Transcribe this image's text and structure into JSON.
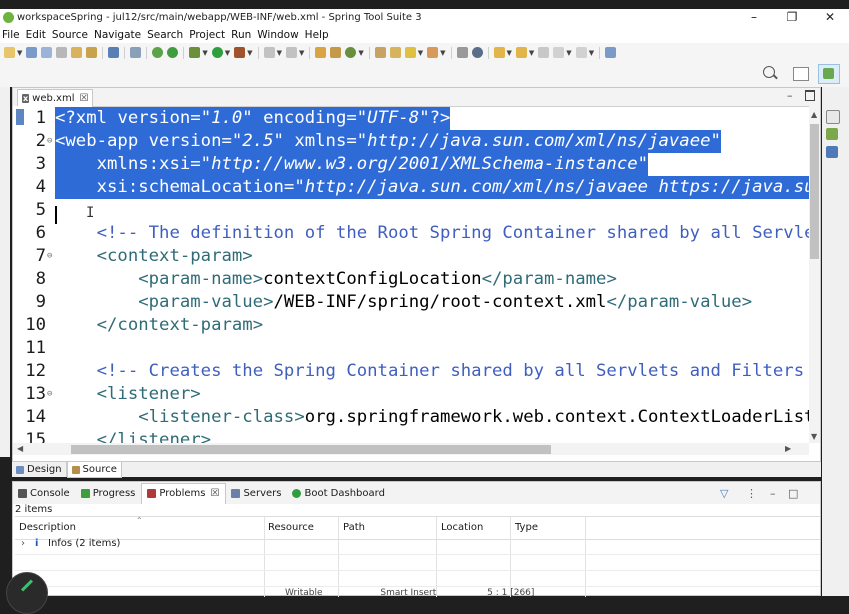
{
  "window": {
    "title": "workspaceSpring - jul12/src/main/webapp/WEB-INF/web.xml - Spring Tool Suite 3",
    "minimize": "–",
    "restore": "❐",
    "close": "✕"
  },
  "menu": [
    "File",
    "Edit",
    "Source",
    "Navigate",
    "Search",
    "Project",
    "Run",
    "Window",
    "Help"
  ],
  "colors": {
    "selection": "#2f6bd7",
    "tag": "#2f6c77",
    "attribute": "#7c1f7c",
    "string": "#2a00ff",
    "comment": "#3f5fbf"
  },
  "editor": {
    "tab": {
      "icon": "x",
      "label": "web.xml",
      "close": "☒"
    },
    "lines": [
      {
        "n": "1",
        "fold": "",
        "text": "<?xml version=\"1.0\" encoding=\"UTF-8\"?>"
      },
      {
        "n": "2",
        "fold": "⊖",
        "text": "<web-app version=\"2.5\" xmlns=\"http://java.sun.com/xml/ns/javaee\""
      },
      {
        "n": "3",
        "fold": "",
        "text": "    xmlns:xsi=\"http://www.w3.org/2001/XMLSchema-instance\""
      },
      {
        "n": "4",
        "fold": "",
        "text": "    xsi:schemaLocation=\"http://java.sun.com/xml/ns/javaee https://java.sun."
      },
      {
        "n": "5",
        "fold": "",
        "text": ""
      },
      {
        "n": "6",
        "fold": "",
        "text": "    <!-- The definition of the Root Spring Container shared by all Servlets"
      },
      {
        "n": "7",
        "fold": "⊖",
        "text": "    <context-param>"
      },
      {
        "n": "8",
        "fold": "",
        "text": "        <param-name>contextConfigLocation</param-name>"
      },
      {
        "n": "9",
        "fold": "",
        "text": "        <param-value>/WEB-INF/spring/root-context.xml</param-value>"
      },
      {
        "n": "10",
        "fold": "",
        "text": "    </context-param>"
      },
      {
        "n": "11",
        "fold": "",
        "text": ""
      },
      {
        "n": "12",
        "fold": "",
        "text": "    <!-- Creates the Spring Container shared by all Servlets and Filters --"
      },
      {
        "n": "13",
        "fold": "⊖",
        "text": "    <listener>"
      },
      {
        "n": "14",
        "fold": "",
        "text": "        <listener-class>org.springframework.web.context.ContextLoaderListen"
      },
      {
        "n": "15",
        "fold": "",
        "text": "    </listener>"
      }
    ],
    "bottom_tabs": [
      "Design",
      "Source"
    ]
  },
  "problems_panel": {
    "tabs": [
      "Console",
      "Progress",
      "Problems",
      "Servers",
      "Boot Dashboard"
    ],
    "items_count": "2 items",
    "columns": [
      "Description",
      "Resource",
      "Path",
      "Location",
      "Type"
    ],
    "rows": [
      {
        "expander": "›",
        "icon": "i",
        "description": "Infos (2 items)"
      }
    ]
  },
  "status_bar": {
    "writable": "Writable",
    "insert_mode": "Smart Insert",
    "position": "5 : 1 [266]"
  }
}
